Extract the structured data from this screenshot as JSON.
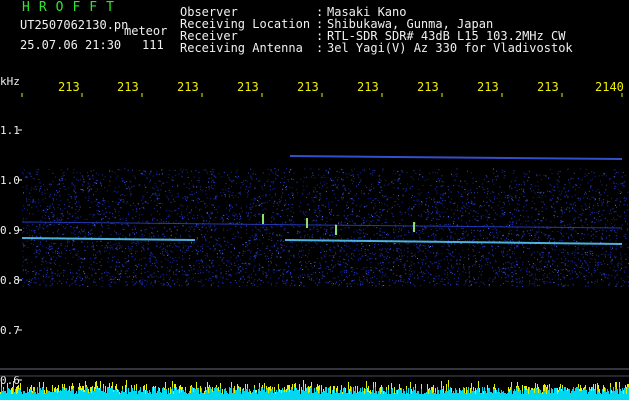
{
  "header": {
    "app_title": "HROFFT",
    "filename": "UT2507062130.pn",
    "meteor_label": "meteor",
    "datetime": "25.07.06 21:30",
    "count": "111"
  },
  "info": [
    {
      "label": "Observer",
      "value": "Masaki Kano"
    },
    {
      "label": "Receiving Location",
      "value": "Shibukawa, Gunma, Japan"
    },
    {
      "label": "Receiver",
      "value": "RTL-SDR SDR# 43dB L15 103.2MHz CW"
    },
    {
      "label": "Receiving Antenna",
      "value": "3el Yagi(V) Az 330 for Vladivostok"
    }
  ],
  "time_axis": {
    "unit_label": "kHz",
    "ticks": [
      "213",
      "213",
      "213",
      "213",
      "213",
      "213",
      "213",
      "213",
      "213",
      "2140"
    ]
  },
  "freq_axis": {
    "ticks": [
      "1.1",
      "1.0",
      "0.9",
      "0.8",
      "0.7",
      "0.6"
    ]
  },
  "colors": {
    "background": "#000000",
    "noise": "#2238c8",
    "carrier": "#5ad0ff",
    "spectrum_low": "#00d8f0",
    "spectrum_high": "#e8f000"
  }
}
